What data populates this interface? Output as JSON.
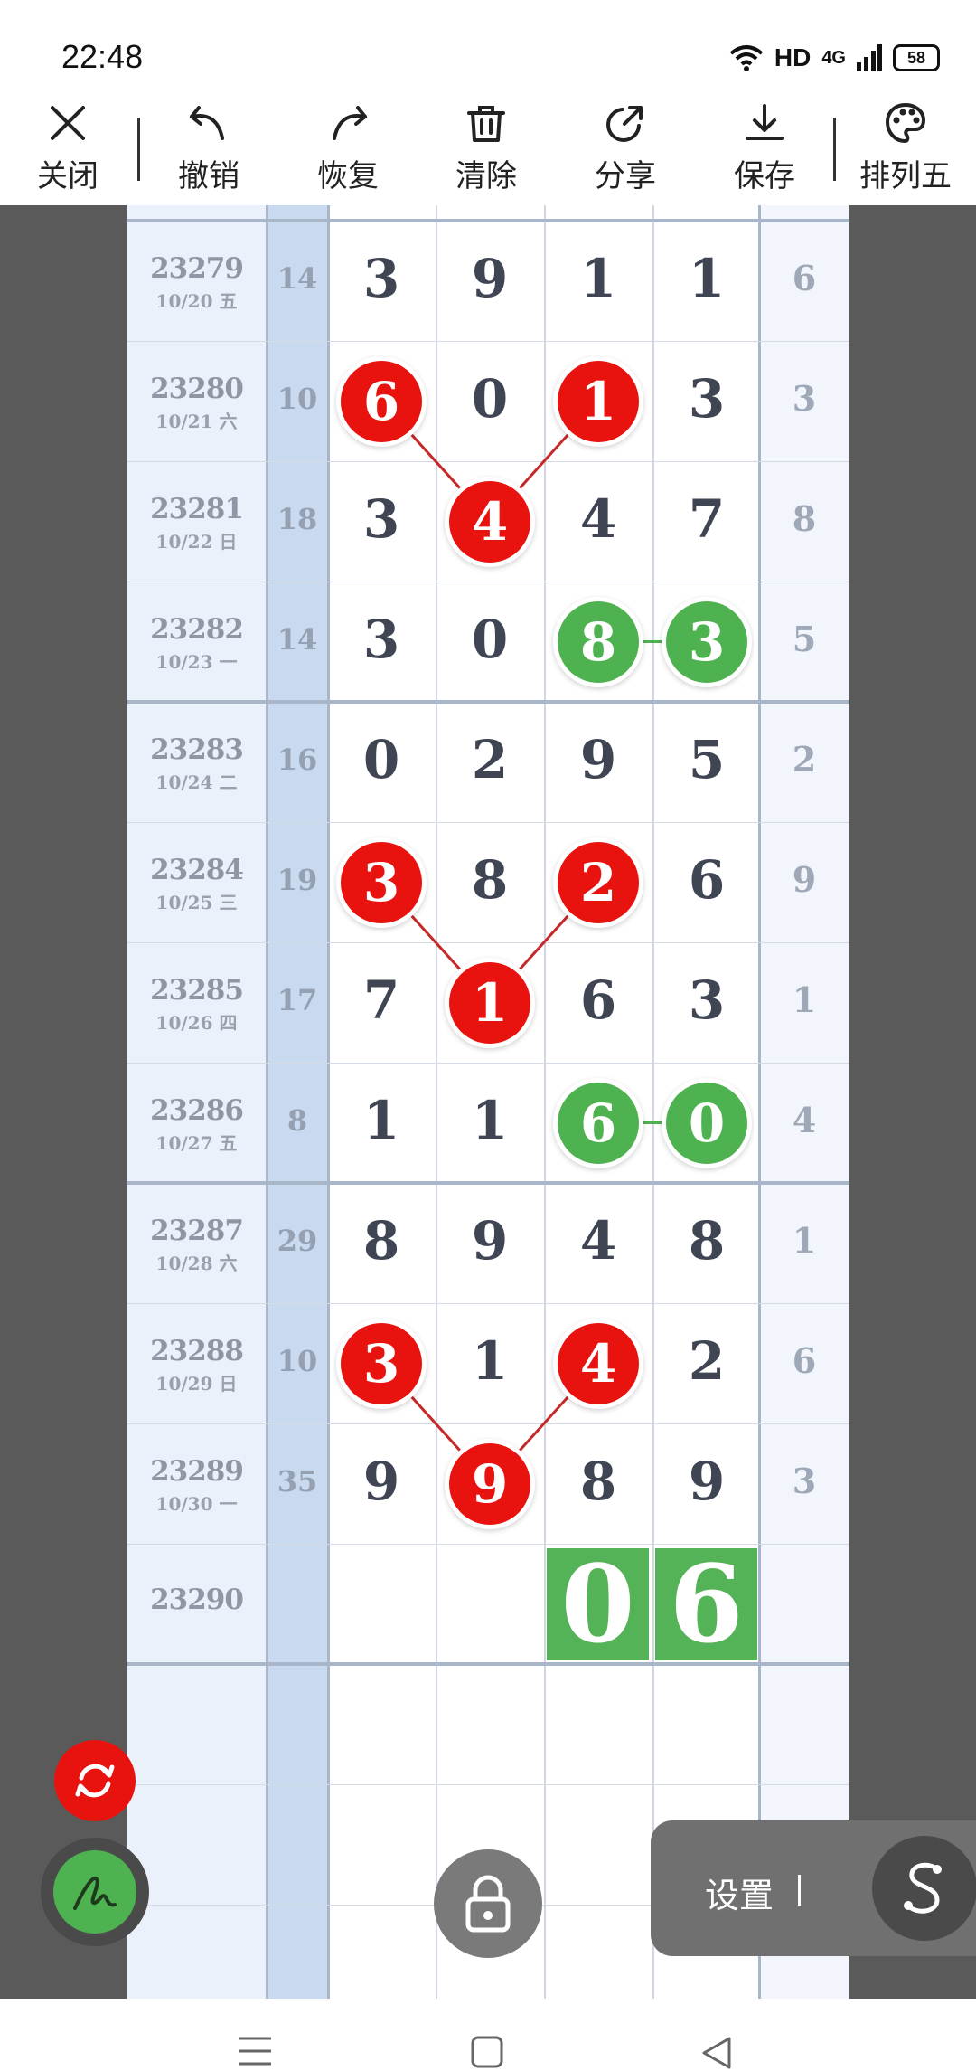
{
  "status": {
    "time": "22:48",
    "hd": "HD",
    "network": "4G",
    "battery": "58"
  },
  "toolbar": [
    {
      "label": "关闭",
      "icon": "close-icon"
    },
    {
      "label": "撤销",
      "icon": "undo-icon"
    },
    {
      "label": "恢复",
      "icon": "redo-icon"
    },
    {
      "label": "清除",
      "icon": "trash-icon"
    },
    {
      "label": "分享",
      "icon": "share-icon"
    },
    {
      "label": "保存",
      "icon": "download-icon"
    },
    {
      "label": "排列五",
      "icon": "palette-icon"
    }
  ],
  "rows": [
    {
      "id": "23279",
      "date": "10/20 五",
      "sum": "14",
      "digits": [
        "3",
        "9",
        "1",
        "1"
      ],
      "last": "6"
    },
    {
      "id": "23280",
      "date": "10/21 六",
      "sum": "10",
      "digits": [
        "6",
        "0",
        "1",
        "3"
      ],
      "last": "3"
    },
    {
      "id": "23281",
      "date": "10/22 日",
      "sum": "18",
      "digits": [
        "3",
        "4",
        "4",
        "7"
      ],
      "last": "8"
    },
    {
      "id": "23282",
      "date": "10/23 一",
      "sum": "14",
      "digits": [
        "3",
        "0",
        "8",
        "3"
      ],
      "last": "5"
    },
    {
      "id": "23283",
      "date": "10/24 二",
      "sum": "16",
      "digits": [
        "0",
        "2",
        "9",
        "5"
      ],
      "last": "2"
    },
    {
      "id": "23284",
      "date": "10/25 三",
      "sum": "19",
      "digits": [
        "3",
        "8",
        "2",
        "6"
      ],
      "last": "9"
    },
    {
      "id": "23285",
      "date": "10/26 四",
      "sum": "17",
      "digits": [
        "7",
        "1",
        "6",
        "3"
      ],
      "last": "1"
    },
    {
      "id": "23286",
      "date": "10/27 五",
      "sum": "8",
      "digits": [
        "1",
        "1",
        "6",
        "0"
      ],
      "last": "4"
    },
    {
      "id": "23287",
      "date": "10/28 六",
      "sum": "29",
      "digits": [
        "8",
        "9",
        "4",
        "8"
      ],
      "last": "1"
    },
    {
      "id": "23288",
      "date": "10/29 日",
      "sum": "10",
      "digits": [
        "3",
        "1",
        "4",
        "2"
      ],
      "last": "6"
    },
    {
      "id": "23289",
      "date": "10/30 一",
      "sum": "35",
      "digits": [
        "9",
        "9",
        "8",
        "9"
      ],
      "last": "3"
    },
    {
      "id": "23290",
      "date": "",
      "sum": "",
      "digits": [
        "",
        "",
        "0",
        "6"
      ],
      "last": ""
    }
  ],
  "markers": {
    "red_groups": [
      [
        [
          1,
          0
        ],
        [
          2,
          1
        ],
        [
          1,
          2
        ]
      ],
      [
        [
          5,
          0
        ],
        [
          6,
          1
        ],
        [
          5,
          2
        ]
      ],
      [
        [
          9,
          0
        ],
        [
          10,
          1
        ],
        [
          9,
          2
        ]
      ]
    ],
    "green_pairs": [
      [
        [
          3,
          2
        ],
        [
          3,
          3
        ]
      ],
      [
        [
          7,
          2
        ],
        [
          7,
          3
        ]
      ]
    ],
    "big_tiles": [
      [
        11,
        2
      ],
      [
        11,
        3
      ]
    ]
  },
  "colors": {
    "red": "#e8120f",
    "green": "#4eb250",
    "tile_green": "#55b357",
    "line_red": "#c62828",
    "line_green": "#4eb250"
  },
  "overlay": {
    "settings_label": "设置"
  }
}
